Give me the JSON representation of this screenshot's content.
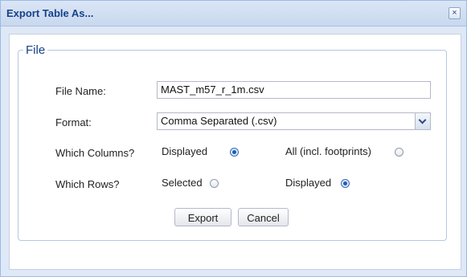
{
  "dialog": {
    "title": "Export Table As...",
    "close_glyph": "×",
    "close_icon": "close-icon"
  },
  "file_section": {
    "legend": "File",
    "file_name_label": "File Name:",
    "file_name_value": "MAST_m57_r_1m.csv",
    "format_label": "Format:",
    "format_value": "Comma Separated (.csv)",
    "format_trigger_icon": "chevron-down-icon",
    "columns_label": "Which Columns?",
    "columns_options": [
      {
        "label": "Displayed",
        "checked": true
      },
      {
        "label": "All (incl. footprints)",
        "checked": false
      }
    ],
    "rows_label": "Which Rows?",
    "rows_options": [
      {
        "label": "Selected",
        "checked": false
      },
      {
        "label": "Displayed",
        "checked": true
      }
    ]
  },
  "buttons": {
    "export_label": "Export",
    "cancel_label": "Cancel"
  },
  "colors": {
    "title_text": "#15428b",
    "window_border": "#99bbe8",
    "radio_checked": "#1d5db5"
  }
}
